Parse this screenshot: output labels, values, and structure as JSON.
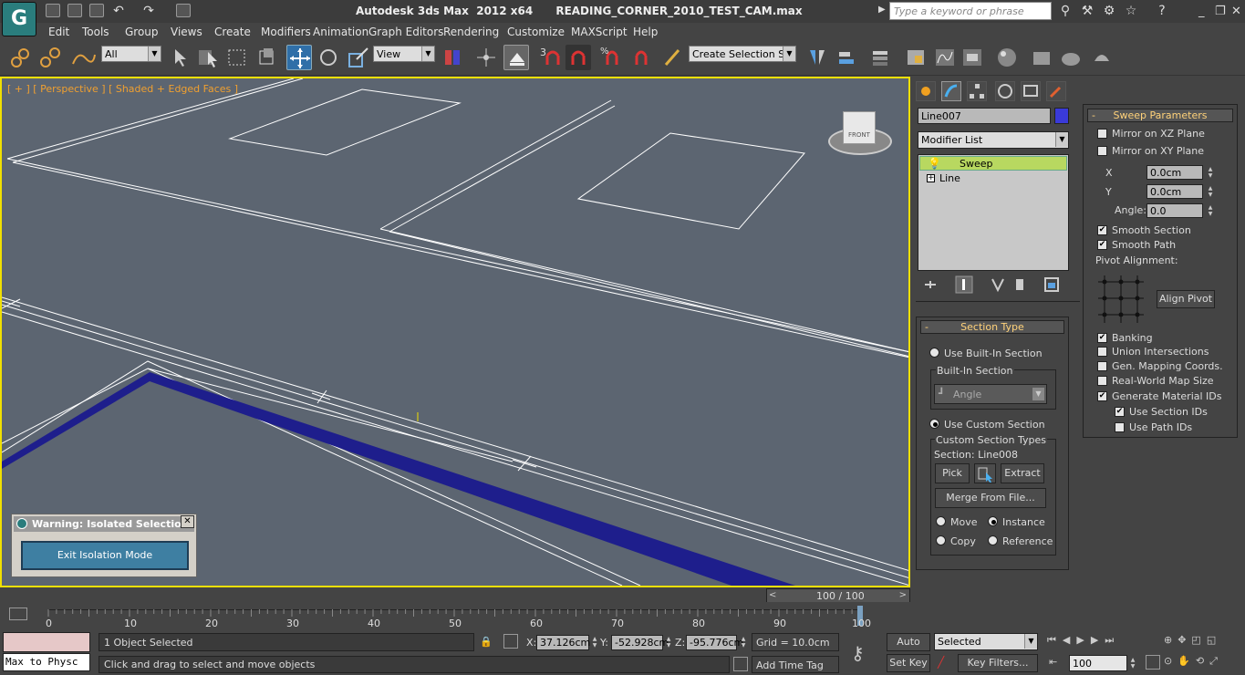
{
  "title": {
    "app": "Autodesk 3ds Max  2012 x64",
    "file": "READING_CORNER_2010_TEST_CAM.max",
    "search_placeholder": "Type a keyword or phrase"
  },
  "menu": [
    "Edit",
    "Tools",
    "Group",
    "Views",
    "Create",
    "Modifiers",
    "Animation",
    "Graph Editors",
    "Rendering",
    "Customize",
    "MAXScript",
    "Help"
  ],
  "toolbar": {
    "selection_filter": "All",
    "reference_coord": "View",
    "snap_label": "3",
    "selection_set": "Create Selection Se"
  },
  "viewport": {
    "label": "[ + ] [ Perspective ] [ Shaded + Edged Faces ]",
    "viewcube_label": "FRONT"
  },
  "warning": {
    "title": "Warning: Isolated Selection",
    "button": "Exit Isolation Mode"
  },
  "panel": {
    "object_name": "Line007",
    "object_color": "#3a3ad8",
    "modifier_list": "Modifier List",
    "stack": [
      "Sweep",
      "Line"
    ],
    "section_type": {
      "header": "Section Type",
      "use_builtin": "Use Built-In Section",
      "builtin_group": "Built-In Section",
      "builtin_value": "Angle",
      "use_custom": "Use Custom Section",
      "custom_group": "Custom Section Types",
      "section": "Section: Line008",
      "pick": "Pick",
      "extract": "Extract",
      "merge": "Merge From File...",
      "move": "Move",
      "instance": "Instance",
      "copy": "Copy",
      "reference": "Reference"
    },
    "sweep": {
      "header": "Sweep Parameters",
      "mirror_xz": "Mirror on XZ Plane",
      "mirror_xy": "Mirror on XY Plane",
      "x_label": "X",
      "x": "0.0cm",
      "y_label": "Y",
      "y": "0.0cm",
      "angle_label": "Angle:",
      "angle": "0.0",
      "smooth_section": "Smooth Section",
      "smooth_path": "Smooth Path",
      "pivot": "Pivot Alignment:",
      "align_pivot": "Align Pivot",
      "banking": "Banking",
      "union": "Union Intersections",
      "gen_mapping": "Gen. Mapping Coords.",
      "real_world": "Real-World Map Size",
      "gen_mat": "Generate Material IDs",
      "use_section_ids": "Use Section IDs",
      "use_path_ids": "Use Path IDs"
    }
  },
  "timeline": {
    "frame": "100 / 100",
    "ticks": [
      "0",
      "10",
      "20",
      "30",
      "40",
      "50",
      "60",
      "70",
      "80",
      "90",
      "100"
    ]
  },
  "status": {
    "maxscript": "Max to Physc",
    "selected": "1 Object Selected",
    "prompt": "Click and drag to select and move objects",
    "x_label": "X:",
    "x": "37.126cm",
    "y_label": "Y:",
    "y": "-52.928cm",
    "z_label": "Z:",
    "z": "-95.776cm",
    "grid": "Grid = 10.0cm",
    "time_tag": "Add Time Tag",
    "auto_key": "Auto Key",
    "set_key": "Set Key",
    "key_mode": "Selected",
    "key_filters": "Key Filters...",
    "frame_field": "100"
  }
}
